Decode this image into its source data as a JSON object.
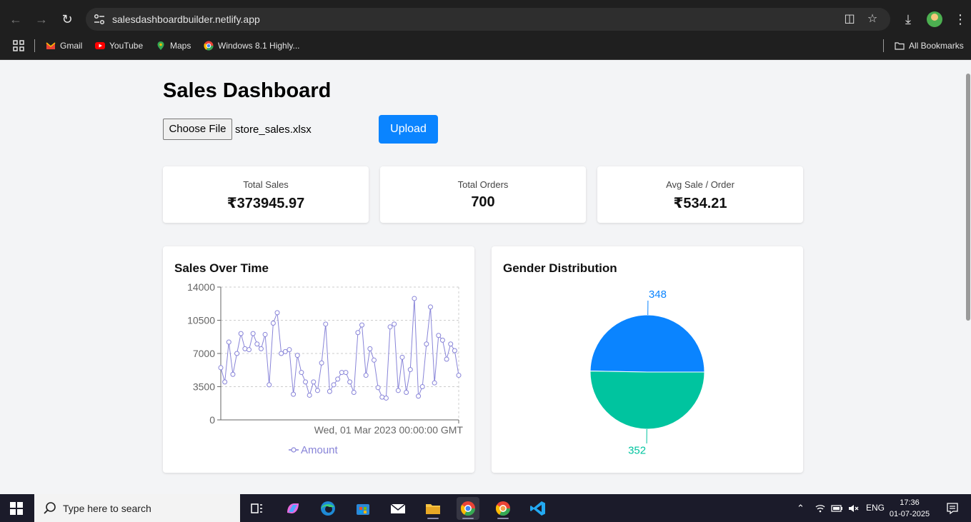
{
  "browser": {
    "url": "salesdashboardbuilder.netlify.app",
    "bookmarks": [
      "Gmail",
      "YouTube",
      "Maps",
      "Windows 8.1 Highly..."
    ],
    "all_bookmarks": "All Bookmarks"
  },
  "page": {
    "title": "Sales Dashboard",
    "choose_file_label": "Choose File",
    "file_name": "store_sales.xlsx",
    "upload_label": "Upload"
  },
  "stats": [
    {
      "label": "Total Sales",
      "value": "₹373945.97"
    },
    {
      "label": "Total Orders",
      "value": "700"
    },
    {
      "label": "Avg Sale / Order",
      "value": "₹534.21"
    }
  ],
  "charts": {
    "line_title": "Sales Over Time",
    "pie_title": "Gender Distribution"
  },
  "chart_data": [
    {
      "type": "line",
      "title": "Sales Over Time",
      "xlabel": "",
      "ylabel": "",
      "x_tick_label": "Wed, 01 Mar 2023 00:00:00 GMT",
      "yticks": [
        0,
        3500,
        7000,
        10500,
        14000
      ],
      "ylim": [
        0,
        14000
      ],
      "grid": true,
      "legend": "bottom",
      "color": "#8884d8",
      "series": [
        {
          "name": "Amount",
          "values": [
            5500,
            4000,
            8200,
            4800,
            7000,
            9100,
            7500,
            7400,
            9100,
            8000,
            7500,
            9000,
            3700,
            10200,
            11300,
            7000,
            7200,
            7400,
            2700,
            6800,
            5000,
            4000,
            2600,
            4000,
            3100,
            6000,
            10100,
            3000,
            3700,
            4300,
            5000,
            5000,
            4000,
            2900,
            9200,
            10000,
            4700,
            7500,
            6300,
            3400,
            2400,
            2300,
            9800,
            10100,
            3100,
            6600,
            2900,
            5300,
            12800,
            2500,
            3500,
            8000,
            11900,
            3900,
            8900,
            8400,
            6400,
            8000,
            7300,
            4700
          ]
        }
      ]
    },
    {
      "type": "pie",
      "title": "Gender Distribution",
      "slices": [
        {
          "label": "348",
          "value": 348,
          "color": "#0a84ff"
        },
        {
          "label": "352",
          "value": 352,
          "color": "#00c49f"
        }
      ]
    }
  ],
  "taskbar": {
    "search_placeholder": "Type here to search",
    "lang": "ENG",
    "time": "17:36",
    "date": "01-07-2025"
  }
}
